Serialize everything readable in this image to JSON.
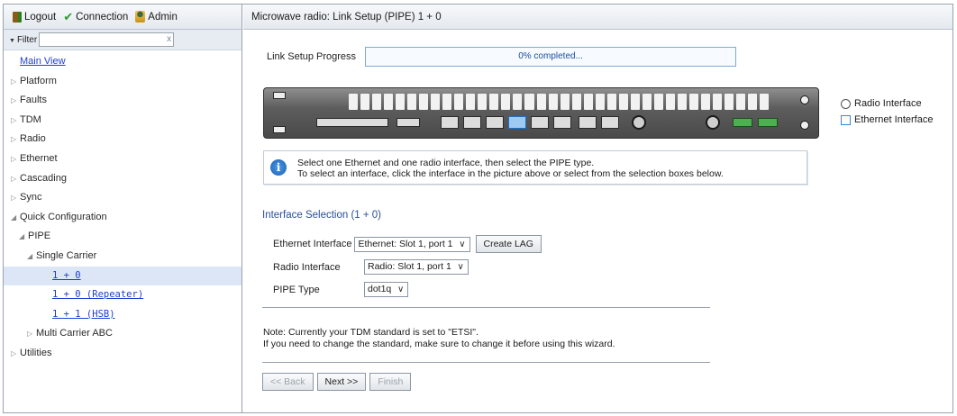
{
  "topbar": {
    "logout": "Logout",
    "connection": "Connection",
    "admin": "Admin"
  },
  "filter": {
    "label": "Filter",
    "value": "",
    "clear": "x"
  },
  "tree": [
    {
      "label": "Main View",
      "indent": 0,
      "arrow": "",
      "link": true
    },
    {
      "label": "Platform",
      "indent": 0,
      "arrow": "▷"
    },
    {
      "label": "Faults",
      "indent": 0,
      "arrow": "▷"
    },
    {
      "label": "TDM",
      "indent": 0,
      "arrow": "▷"
    },
    {
      "label": "Radio",
      "indent": 0,
      "arrow": "▷"
    },
    {
      "label": "Ethernet",
      "indent": 0,
      "arrow": "▷"
    },
    {
      "label": "Cascading",
      "indent": 0,
      "arrow": "▷"
    },
    {
      "label": "Sync",
      "indent": 0,
      "arrow": "▷"
    },
    {
      "label": "Quick Configuration",
      "indent": 0,
      "arrow": "◢"
    },
    {
      "label": "PIPE",
      "indent": 1,
      "arrow": "◢"
    },
    {
      "label": "Single Carrier",
      "indent": 2,
      "arrow": "◢"
    },
    {
      "label": "1 + 0",
      "indent": 4,
      "arrow": "",
      "link": true,
      "mono": true,
      "selected": true
    },
    {
      "label": "1 + 0 (Repeater)",
      "indent": 4,
      "arrow": "",
      "link": true,
      "mono": true
    },
    {
      "label": "1 + 1 (HSB)",
      "indent": 4,
      "arrow": "",
      "link": true,
      "mono": true
    },
    {
      "label": "Multi Carrier ABC",
      "indent": 2,
      "arrow": "▷"
    },
    {
      "label": "Utilities",
      "indent": 0,
      "arrow": "▷"
    }
  ],
  "main": {
    "title": "Microwave radio: Link Setup (PIPE) 1 + 0",
    "progress_label": "Link Setup Progress",
    "progress_text": "0% completed...",
    "progress_fraction": 0,
    "legend": {
      "radio": "Radio Interface",
      "ethernet": "Ethernet Interface"
    },
    "info_line1": "Select one Ethernet and one radio interface, then select the PIPE type.",
    "info_line2": "To select an interface, click the interface in the picture above or select from the selection boxes below.",
    "section_title": "Interface Selection (1 + 0)",
    "ethernet_label": "Ethernet Interface",
    "ethernet_value": "Ethernet: Slot 1, port 1",
    "create_lag": "Create LAG",
    "radio_label": "Radio Interface",
    "radio_value": "Radio: Slot 1, port 1",
    "pipe_label": "PIPE Type",
    "pipe_value": "dot1q",
    "note_line1": "Note: Currently your TDM standard is set to \"ETSI\".",
    "note_line2": "If you need to change the standard, make sure to change it before using this wizard.",
    "back": "<< Back",
    "next": "Next >>",
    "finish": "Finish"
  },
  "colors": {
    "link": "#1f3fd1",
    "section": "#2a4f9a",
    "progress_border": "#7fa9d6",
    "ethernet_legend": "#3a86d8",
    "selected_row": "#dde6f6"
  }
}
